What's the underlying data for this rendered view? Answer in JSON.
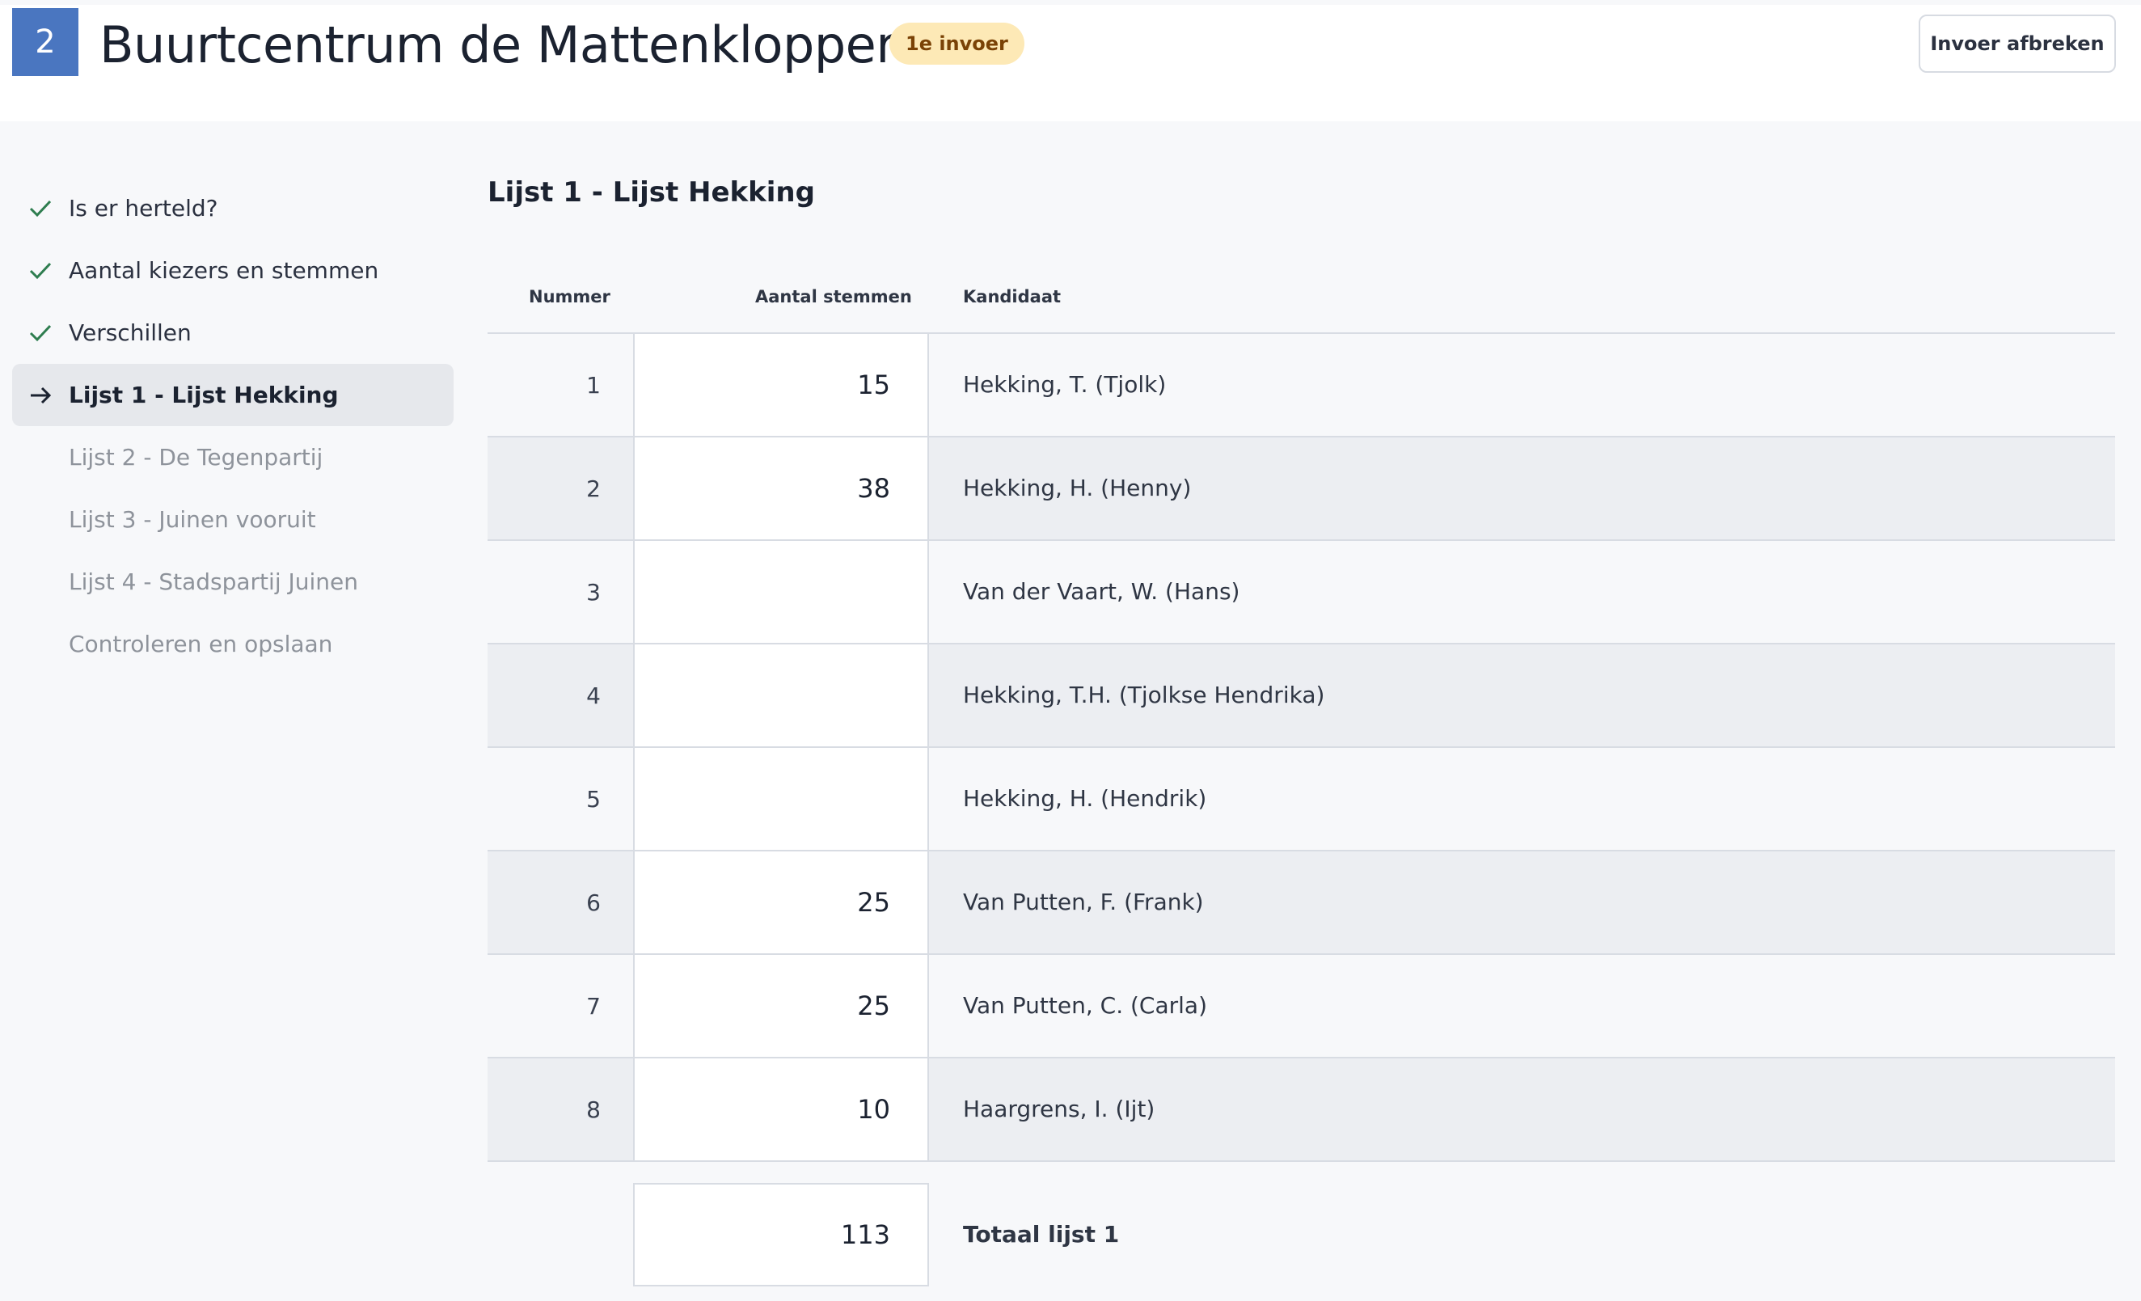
{
  "header": {
    "station_number": "2",
    "station_name": "Buurtcentrum de Mattenklopper",
    "entry_badge": "1e invoer",
    "abort_label": "Invoer afbreken"
  },
  "sidebar": {
    "items": [
      {
        "label": "Is er herteld?",
        "state": "done"
      },
      {
        "label": "Aantal kiezers en stemmen",
        "state": "done"
      },
      {
        "label": "Verschillen",
        "state": "done"
      },
      {
        "label": "Lijst 1 - Lijst Hekking",
        "state": "active"
      },
      {
        "label": "Lijst 2 - De Tegenpartij",
        "state": "todo"
      },
      {
        "label": "Lijst 3 - Juinen vooruit",
        "state": "todo"
      },
      {
        "label": "Lijst 4 - Stadspartij Juinen",
        "state": "todo"
      },
      {
        "label": "Controleren en opslaan",
        "state": "todo"
      }
    ]
  },
  "main": {
    "title": "Lijst 1 - Lijst Hekking",
    "columns": {
      "number": "Nummer",
      "votes": "Aantal stemmen",
      "candidate": "Kandidaat"
    },
    "rows": [
      {
        "number": "1",
        "votes": "15",
        "candidate": "Hekking, T. (Tjolk)"
      },
      {
        "number": "2",
        "votes": "38",
        "candidate": "Hekking, H. (Henny)"
      },
      {
        "number": "3",
        "votes": "",
        "candidate": "Van der Vaart, W. (Hans)"
      },
      {
        "number": "4",
        "votes": "",
        "candidate": "Hekking, T.H. (Tjolkse Hendrika)"
      },
      {
        "number": "5",
        "votes": "",
        "candidate": "Hekking, H. (Hendrik)"
      },
      {
        "number": "6",
        "votes": "25",
        "candidate": "Van Putten, F. (Frank)"
      },
      {
        "number": "7",
        "votes": "25",
        "candidate": "Van Putten, C. (Carla)"
      },
      {
        "number": "8",
        "votes": "10",
        "candidate": "Haargrens, I. (Ijt)"
      }
    ],
    "total": {
      "value": "113",
      "label": "Totaal lijst 1"
    }
  },
  "colors": {
    "accent": "#4a76c0",
    "badge_bg": "#fde9b6",
    "badge_text": "#7a4206",
    "check": "#2e7d4f"
  }
}
